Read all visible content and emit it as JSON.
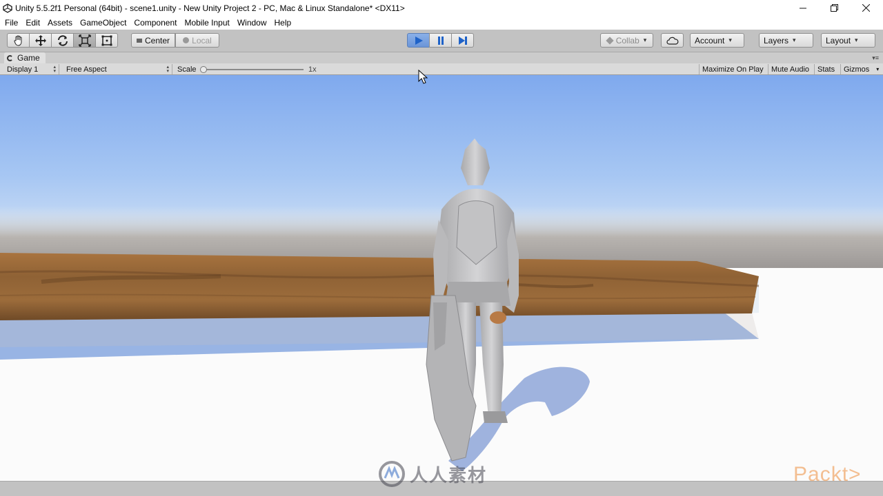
{
  "window": {
    "title": "Unity 5.5.2f1 Personal (64bit) - scene1.unity - New Unity Project 2 - PC, Mac & Linux Standalone* <DX11>"
  },
  "menu": [
    "File",
    "Edit",
    "Assets",
    "GameObject",
    "Component",
    "Mobile Input",
    "Window",
    "Help"
  ],
  "toolbar": {
    "tools": [
      "hand-icon",
      "move-icon",
      "rotate-icon",
      "scale-icon",
      "rect-icon"
    ],
    "pivot": "Center",
    "space": "Local",
    "collab": "Collab",
    "account": "Account",
    "layers": "Layers",
    "layout": "Layout"
  },
  "game_tab": {
    "title": "Game",
    "display": "Display 1",
    "aspect": "Free Aspect",
    "scale_label": "Scale",
    "scale_value": "1x",
    "scale_level": 0.0,
    "maximize": "Maximize On Play",
    "mute": "Mute Audio",
    "stats": "Stats",
    "gizmos": "Gizmos"
  },
  "watermark": {
    "brand_text": "人人素材",
    "packt": "Packt>"
  },
  "colors": {
    "play_active": "#6b95d8",
    "sky_top": "#86aef0",
    "ground": "#ffffff",
    "wood": "#9b6a3a"
  }
}
